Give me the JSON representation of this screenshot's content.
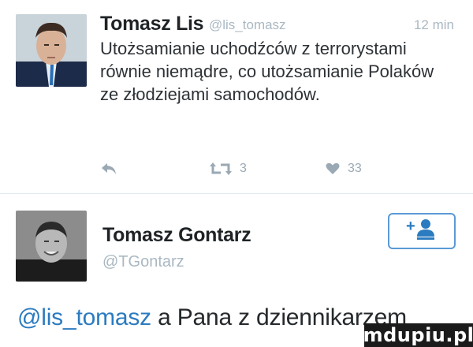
{
  "tweet": {
    "author_name": "Tomasz Lis",
    "author_handle": "@lis_tomasz",
    "time": "12 min",
    "text": "Utożsamianie uchodźców z terrorystami równie niemądre, co utożsamianie Polaków ze złodziejami samochodów.",
    "retweet_count": "3",
    "like_count": "33",
    "icons": {
      "reply": "reply-icon",
      "retweet": "retweet-icon",
      "like": "heart-icon"
    }
  },
  "reply": {
    "author_name": "Tomasz Gontarz",
    "author_handle": "@TGontarz",
    "follow_icon": "follow-user-icon",
    "mention": "@lis_tomasz",
    "text_rest": " a Pana z dziennikarzem"
  },
  "watermark": "mdupiu.pl",
  "colors": {
    "accent": "#2b7bc0",
    "muted": "#aab8c2",
    "text": "#292f33"
  }
}
